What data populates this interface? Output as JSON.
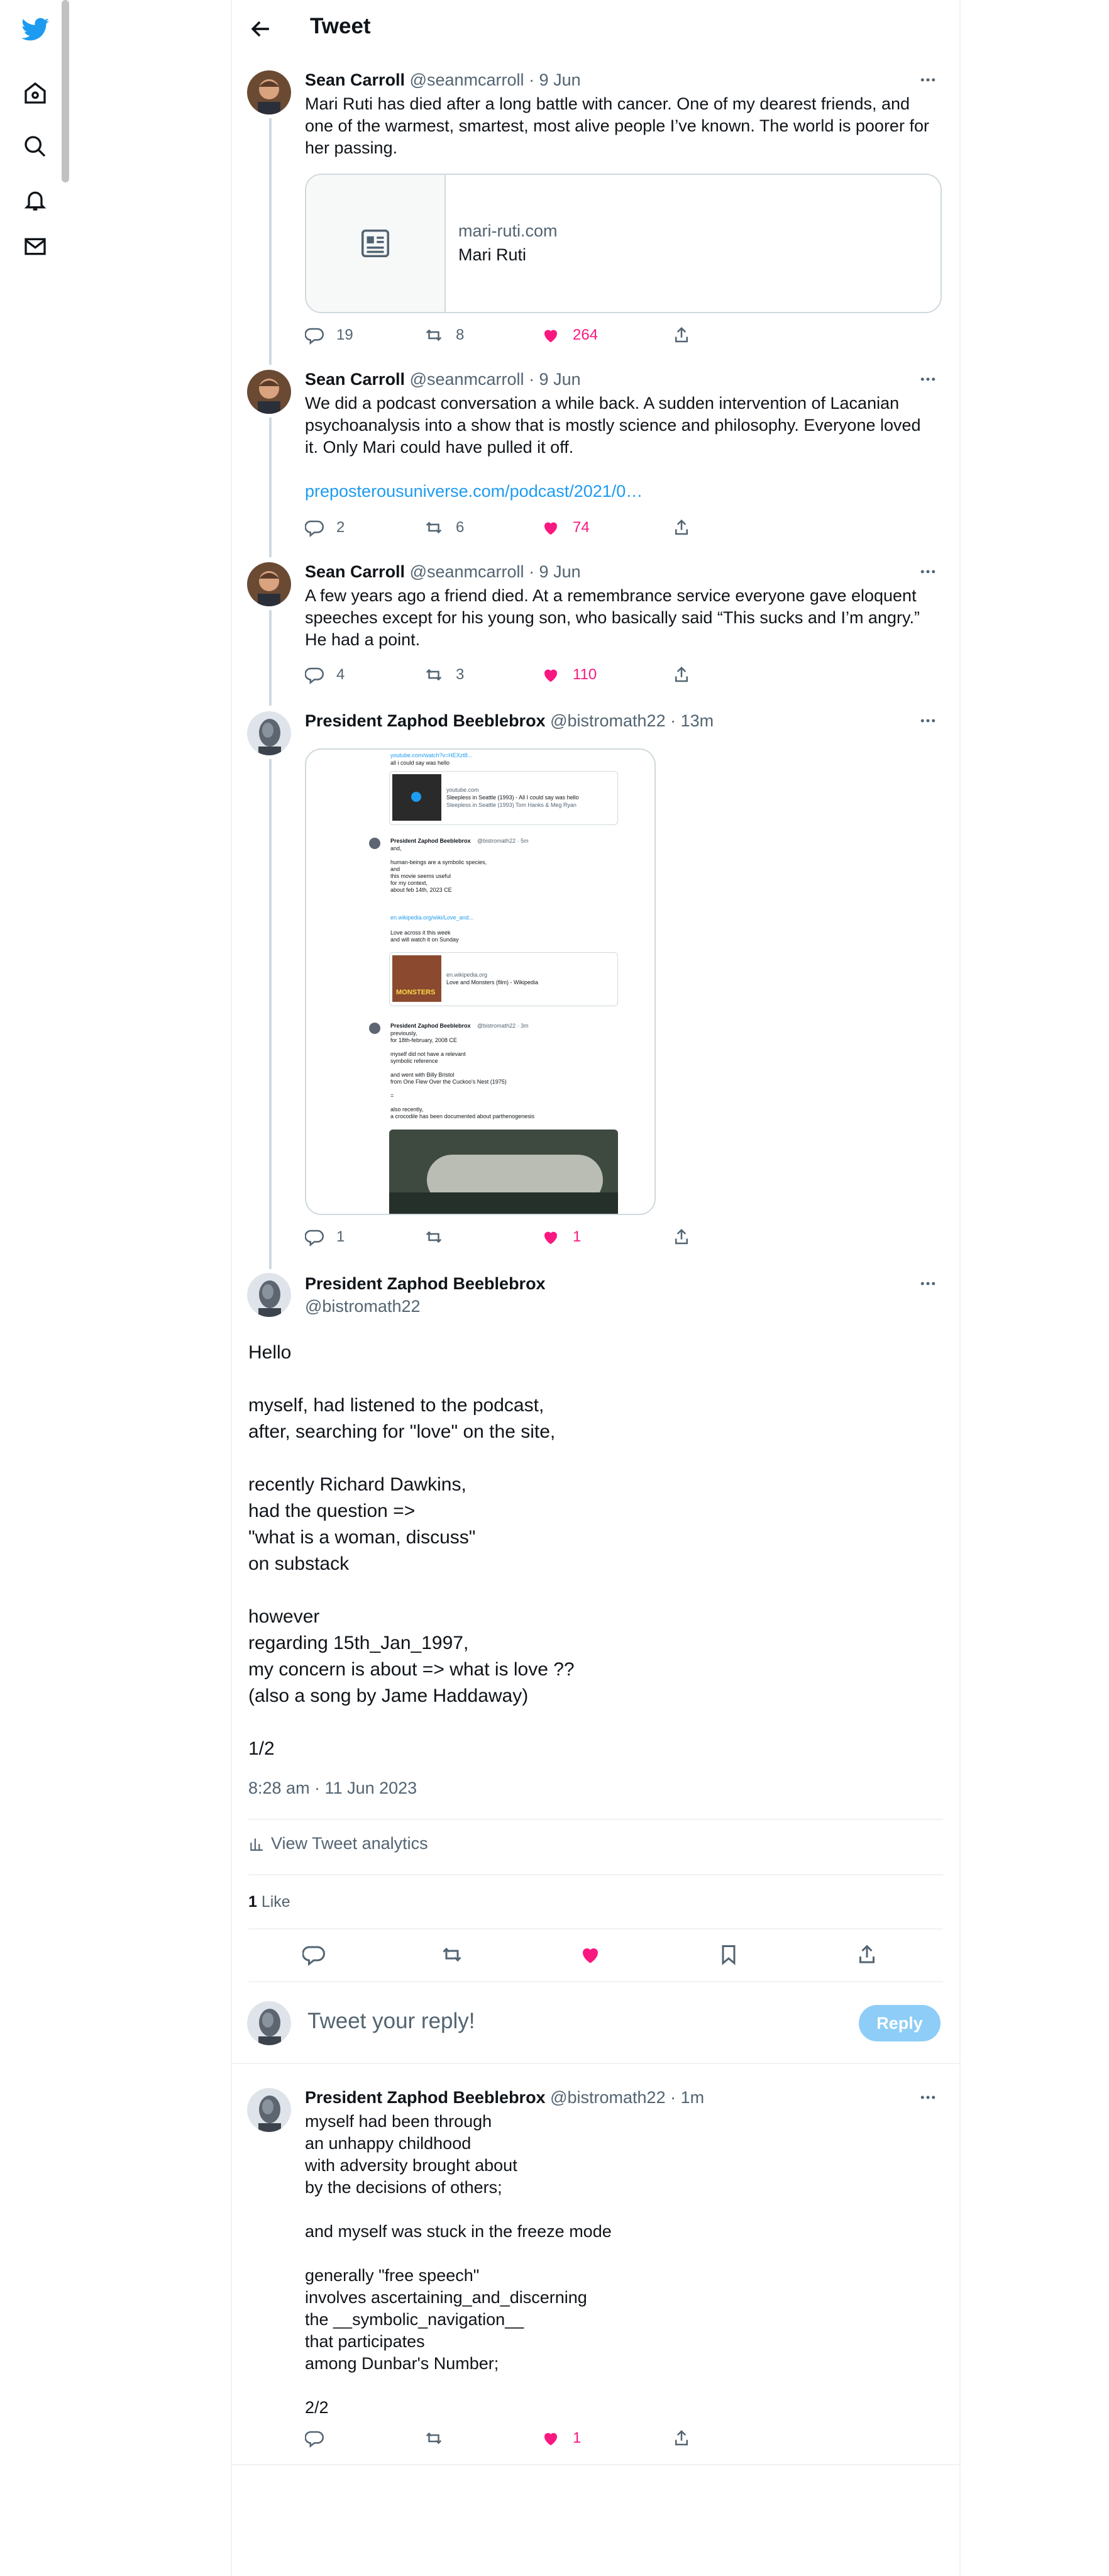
{
  "header": {
    "title": "Tweet"
  },
  "colors": {
    "accent": "#1d9bf0",
    "like": "#f91880",
    "muted": "#536471",
    "border": "#cfd9de"
  },
  "thread": [
    {
      "name": "Sean Carroll",
      "handle": "@seanmcarroll",
      "time": "· 9 Jun",
      "text": "Mari Ruti has died after a long battle with cancer. One of my dearest friends, and one of the warmest, smartest, most alive people I’ve known. The world is poorer for her passing.",
      "card": {
        "domain": "mari-ruti.com",
        "title": "Mari Ruti"
      },
      "replies": "19",
      "retweets": "8",
      "likes": "264"
    },
    {
      "name": "Sean Carroll",
      "handle": "@seanmcarroll",
      "time": "· 9 Jun",
      "text": "We did a podcast conversation a while back. A sudden intervention of Lacanian psychoanalysis into a show that is mostly science and philosophy. Everyone loved it. Only Mari could have pulled it off.",
      "link": "preposterousuniverse.com/podcast/2021/0…",
      "replies": "2",
      "retweets": "6",
      "likes": "74"
    },
    {
      "name": "Sean Carroll",
      "handle": "@seanmcarroll",
      "time": "· 9 Jun",
      "text": "A few years ago a friend died. At a remembrance service everyone gave eloquent speeches except for his young son, who basically said “This sucks and I’m angry.” He had a point.",
      "replies": "4",
      "retweets": "3",
      "likes": "110"
    },
    {
      "name": "President Zaphod Beeblebrox",
      "handle": "@bistromath22",
      "time": "· 13m",
      "replies": "1",
      "retweets": "",
      "likes": "1",
      "screenshot": {
        "link1": "youtube.com/watch?v=HEXzt8...",
        "line1": "all i could say was hello",
        "yt_domain": "youtube.com",
        "yt_title": "Sleepless in Seattle (1993) - All I could say was hello",
        "yt_sub": "Sleepless in Seattle (1993) Tom Hanks & Meg Ryan",
        "name2": "President Zaphod Beeblebrox",
        "handle2": "@bistromath22 · 5m",
        "body2": "and,\n\nhuman-beings are a symbolic species,\nand\nthis movie seems useful\nfor my context,\nabout feb 14th, 2023 CE",
        "link2": "en.wikipedia.org/wiki/Love_and...",
        "body3": "Love across it this week\nand will watch it on Sunday",
        "wiki_domain": "en.wikipedia.org",
        "wiki_title": "Love and Monsters (film) - Wikipedia",
        "poster_label": "MONSTERS",
        "name3": "President Zaphod Beeblebrox",
        "handle3": "@bistromath22 · 3m",
        "body4": "previously,\nfor 18th-february, 2008 CE\n\nmyself did not have a relevant\nsymbolic reference\n\nand went with Billy Bristol\nfrom One Flew Over the Cuckoo's Nest (1975)\n\n=\n\nalso recently,\na crocodile has been documented about parthenogenesis"
      }
    }
  ],
  "main_tweet": {
    "name": "President Zaphod Beeblebrox",
    "handle": "@bistromath22",
    "text": "Hello\n\nmyself, had listened to the podcast,\nafter, searching for \"love\" on the site,\n\nrecently Richard Dawkins,\nhad the question =>\n\"what is a woman, discuss\"\non substack\n\nhowever\nregarding 15th_Jan_1997,\nmy concern is about => what is love ??\n(also a song by Jame Haddaway)\n\n1/2",
    "timestamp": "8:28 am · 11 Jun 2023",
    "analytics": "View Tweet analytics",
    "like_count": "1",
    "like_label": " Like"
  },
  "reply_box": {
    "placeholder": "Tweet your reply!",
    "button": "Reply"
  },
  "reply": {
    "name": "President Zaphod Beeblebrox",
    "handle": "@bistromath22",
    "time": "· 1m",
    "text": "myself had been through\nan unhappy childhood\nwith adversity brought about\nby the decisions of others;\n\nand myself was stuck in the freeze mode\n\ngenerally \"free speech\"\ninvolves ascertaining_and_discerning\nthe __symbolic_navigation__\nthat participates\namong Dunbar's Number;\n\n2/2",
    "replies": "",
    "retweets": "",
    "likes": "1"
  }
}
